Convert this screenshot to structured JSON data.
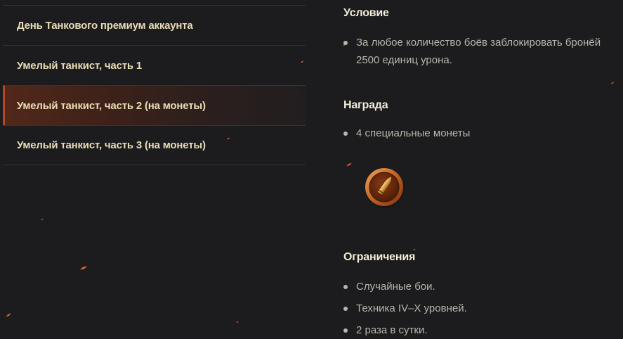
{
  "sidebar": {
    "items": [
      {
        "label": "День Танкового премиум аккаунта",
        "active": false
      },
      {
        "label": "Умелый танкист, часть 1",
        "active": false
      },
      {
        "label": "Умелый танкист, часть 2 (на монеты)",
        "active": true
      },
      {
        "label": "Умелый танкист, часть 3 (на монеты)",
        "active": false
      }
    ]
  },
  "condition": {
    "title": "Условие",
    "bullets": [
      "За любое количество боёв заблокировать бронёй 2500 единиц урона."
    ]
  },
  "reward": {
    "title": "Награда",
    "bullets": [
      "4 специальные монеты"
    ],
    "icon": "bullet-coin-icon"
  },
  "restrictions": {
    "title": "Ограничения",
    "bullets": [
      "Случайные бои.",
      "Техника IV–X уровней.",
      "2 раза в сутки."
    ]
  },
  "colors": {
    "background": "#1c1b1d",
    "menu_text": "#e8dcb6",
    "active_accent": "#b2472a",
    "title_text": "#f2ecd8",
    "body_text": "#b9b6ad"
  }
}
